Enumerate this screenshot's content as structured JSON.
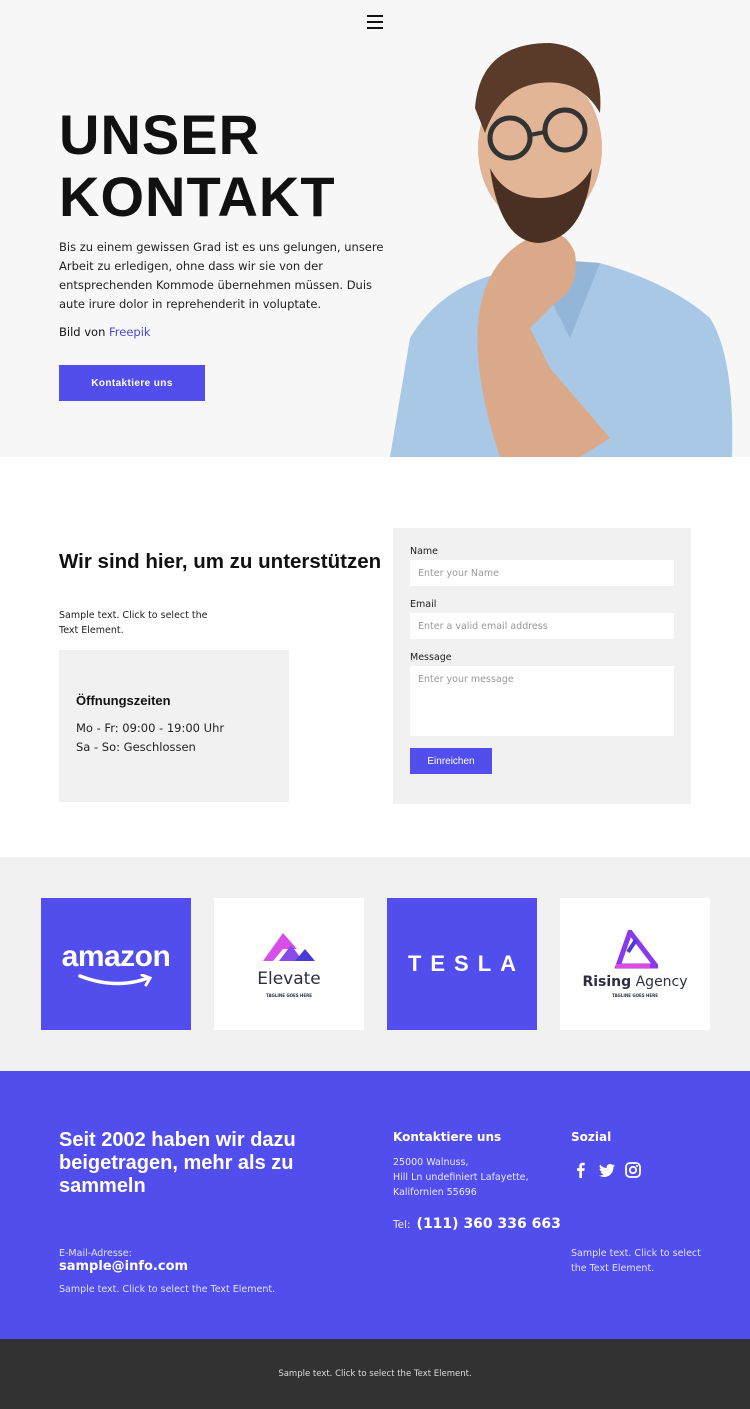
{
  "nav": {
    "menu_icon": "hamburger-menu-icon"
  },
  "hero": {
    "title_line1": "UNSER",
    "title_line2": "KONTAKT",
    "text": "Bis zu einem gewissen Grad ist es uns gelungen, unsere Arbeit zu erledigen, ohne dass wir sie von der entsprechenden Kommode übernehmen müssen. Duis aute irure dolor in reprehenderit in voluptate.",
    "credit_prefix": "Bild von ",
    "credit_link": "Freepik",
    "button": "Kontaktiere uns"
  },
  "support": {
    "heading": "Wir sind hier, um zu unterstützen",
    "sample": "Sample text. Click to select the Text Element.",
    "hours_title": "Öffnungszeiten",
    "hours_weekdays": "Mo - Fr: 09:00 - 19:00 Uhr",
    "hours_weekend": "Sa - So: Geschlossen"
  },
  "form": {
    "name_label": "Name",
    "name_placeholder": "Enter your Name",
    "email_label": "Email",
    "email_placeholder": "Enter a valid email address",
    "message_label": "Message",
    "message_placeholder": "Enter your message",
    "submit": "Einreichen"
  },
  "logos": [
    {
      "name": "amazon",
      "text": "amazon"
    },
    {
      "name": "elevate",
      "text": "Elevate",
      "tagline": "TAGLINE GOES HERE"
    },
    {
      "name": "tesla",
      "text": "TESLA"
    },
    {
      "name": "rising-agency",
      "text_bold": "Rising",
      "text": " Agency",
      "tagline": "TAGLINE GOES HERE"
    }
  ],
  "footer": {
    "heading": "Seit 2002 haben wir dazu beigetragen, mehr als zu sammeln",
    "email_label": "E-Mail-Adresse:",
    "email": "sample@info.com",
    "sample": "Sample text. Click to select the Text Element.",
    "contact_heading": "Kontaktiere uns",
    "address_line1": "25000 Walnuss,",
    "address_line2": "Hill Ln undefiniert Lafayette,",
    "address_line3": "Kalifornien 55696",
    "tel_label": "Tel:",
    "tel": "(111) 360 336 663",
    "social_heading": "Sozial",
    "social_sample": "Sample text. Click to select the Text Element."
  },
  "bottom": {
    "text": "Sample text. Click to select the Text Element."
  },
  "colors": {
    "accent": "#524eee",
    "panel": "#f1f1f1",
    "dark": "#323232"
  }
}
